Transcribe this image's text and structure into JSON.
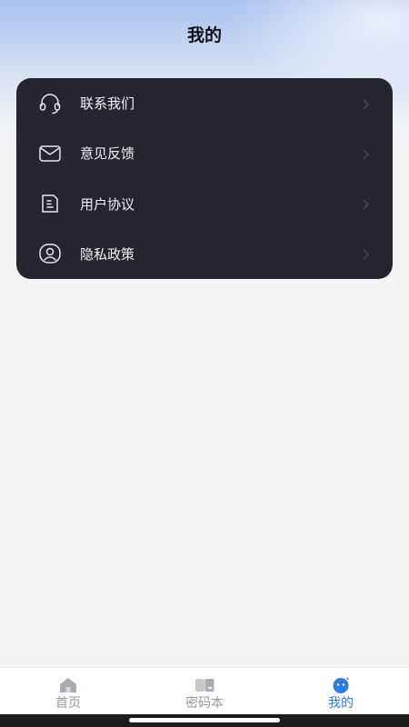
{
  "header": {
    "title": "我的"
  },
  "menu": {
    "items": [
      {
        "label": "联系我们",
        "icon": "headset-icon"
      },
      {
        "label": "意见反馈",
        "icon": "mail-icon"
      },
      {
        "label": "用户协议",
        "icon": "document-icon"
      },
      {
        "label": "隐私政策",
        "icon": "privacy-shield-icon"
      }
    ]
  },
  "tabbar": {
    "tabs": [
      {
        "label": "首页",
        "icon": "home-icon",
        "active": false
      },
      {
        "label": "密码本",
        "icon": "password-book-icon",
        "active": false
      },
      {
        "label": "我的",
        "icon": "profile-face-icon",
        "active": true
      }
    ]
  },
  "colors": {
    "card_bg": "#25252f",
    "accent": "#2f7de1",
    "tab_inactive": "#9a9a9a"
  }
}
